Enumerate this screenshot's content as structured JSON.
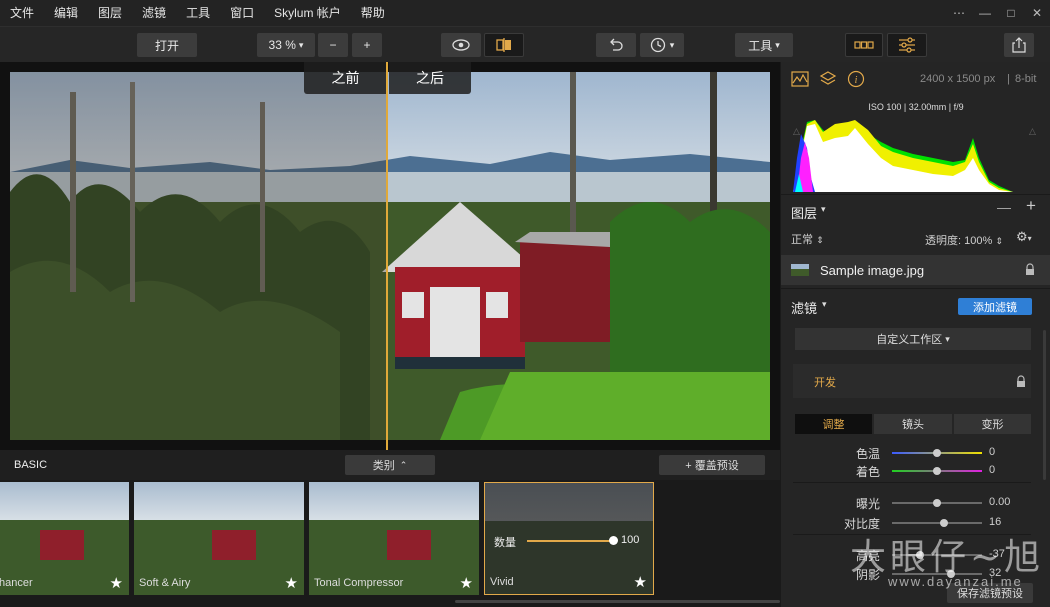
{
  "menu": [
    "文件",
    "编辑",
    "图层",
    "滤镜",
    "工具",
    "窗口",
    "Skylum 帐户",
    "帮助"
  ],
  "window_controls": [
    "⋯",
    "—",
    "□",
    "✕"
  ],
  "toolbar": {
    "open_label": "打开",
    "zoom_label": "33 %",
    "zoom_out": "−",
    "zoom_in": "+",
    "tools_label": "工具"
  },
  "canvas": {
    "before_label": "之前",
    "after_label": "之后",
    "split_position": 0.494
  },
  "presets": {
    "section_label": "BASIC",
    "category_label": "类别",
    "override_label": "+ 覆盖预设",
    "amount_label": "数量",
    "amount_value": "100",
    "amount_fraction": 1.0,
    "items": [
      {
        "name": "hancer"
      },
      {
        "name": "Soft & Airy"
      },
      {
        "name": "Tonal Compressor"
      },
      {
        "name": "Vivid"
      }
    ]
  },
  "info": {
    "dimensions": "2400 x 1500 px",
    "bit_depth": "8-bit",
    "exif": "ISO 100  |  32.00mm  |  f/9"
  },
  "layers": {
    "title": "图层",
    "blend_mode": "正常",
    "opacity_label": "透明度: 100%",
    "layer_name": "Sample image.jpg"
  },
  "filters": {
    "title": "滤镜",
    "add_button": "添加滤镜",
    "workspace_label": "自定义工作区",
    "develop_label": "开发",
    "tabs": [
      "调整",
      "镜头",
      "变形"
    ],
    "active_tab": 0,
    "sliders": [
      {
        "label": "色温",
        "value": "0",
        "position": 0.5
      },
      {
        "label": "着色",
        "value": "0",
        "position": 0.5
      },
      {
        "label": "曝光",
        "value": "0.00",
        "position": 0.5
      },
      {
        "label": "对比度",
        "value": "16",
        "position": 0.58
      },
      {
        "label": "高亮",
        "value": "-37",
        "position": 0.31
      },
      {
        "label": "阴影",
        "value": "32",
        "position": 0.66
      }
    ],
    "save_preset": "保存滤镜预设"
  },
  "watermark": "大眼仔~旭",
  "watermark_url": "www.dayanzai.me",
  "colors": {
    "accent": "#e2a94a",
    "blue_button": "#2f7fd6",
    "histogram_yellow": "#f0f000",
    "histogram_green": "#00e000"
  }
}
